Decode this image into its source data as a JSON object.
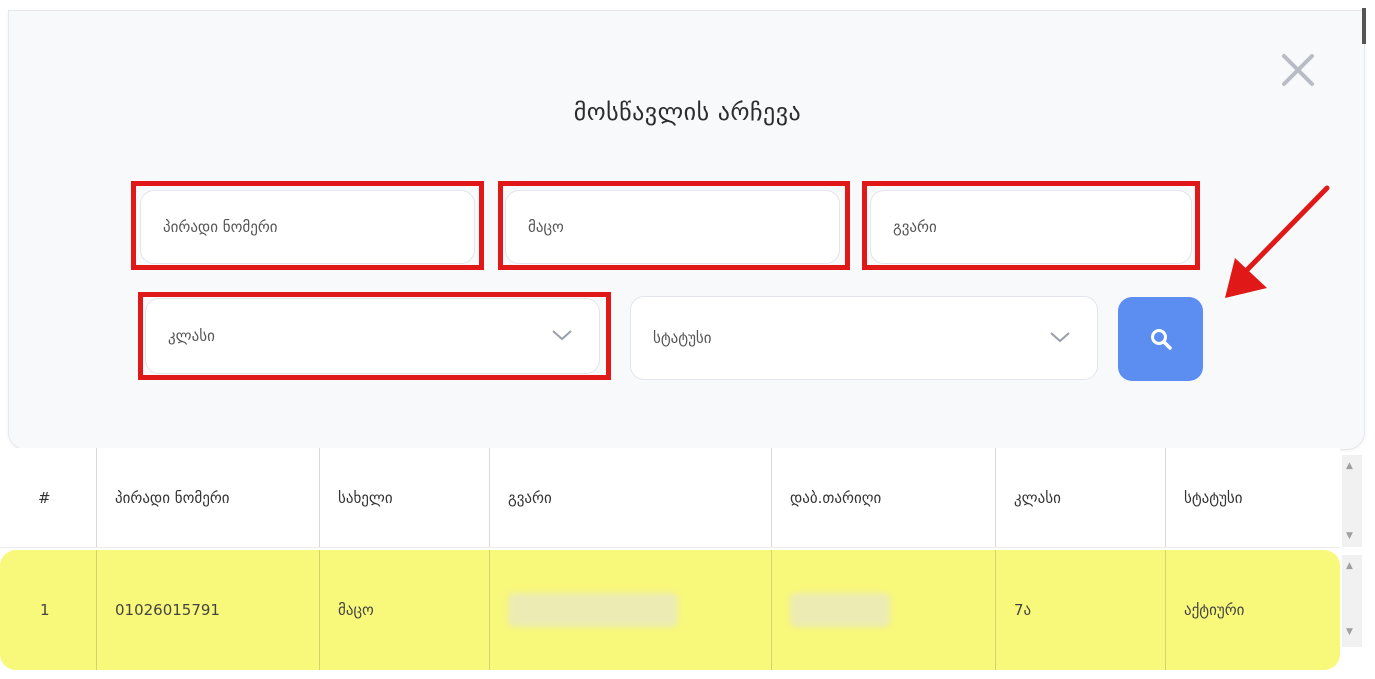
{
  "modal": {
    "title": "მოსწავლის არჩევა",
    "close_icon": "close-icon"
  },
  "filters": {
    "personal_number": {
      "placeholder": "პირადი ნომერი"
    },
    "first_name": {
      "value": "მაცო"
    },
    "last_name": {
      "placeholder": "გვარი"
    },
    "class_select": {
      "value": "კლასი"
    },
    "status_select": {
      "value": "სტატუსი"
    },
    "search_icon": "search-icon"
  },
  "table": {
    "headers": [
      "#",
      "პირადი ნომერი",
      "სახელი",
      "გვარი",
      "დაბ.თარიღი",
      "კლასი",
      "სტატუსი"
    ],
    "rows": [
      {
        "index": "1",
        "personal_number": "01026015791",
        "first_name": "მაცო",
        "last_name": "",
        "birth_date": "",
        "class": "7ა",
        "status": "აქტიური"
      }
    ]
  },
  "colors": {
    "highlight": "#e01818",
    "search_button": "#5c8ef2",
    "selected_row": "#f8f87a"
  }
}
